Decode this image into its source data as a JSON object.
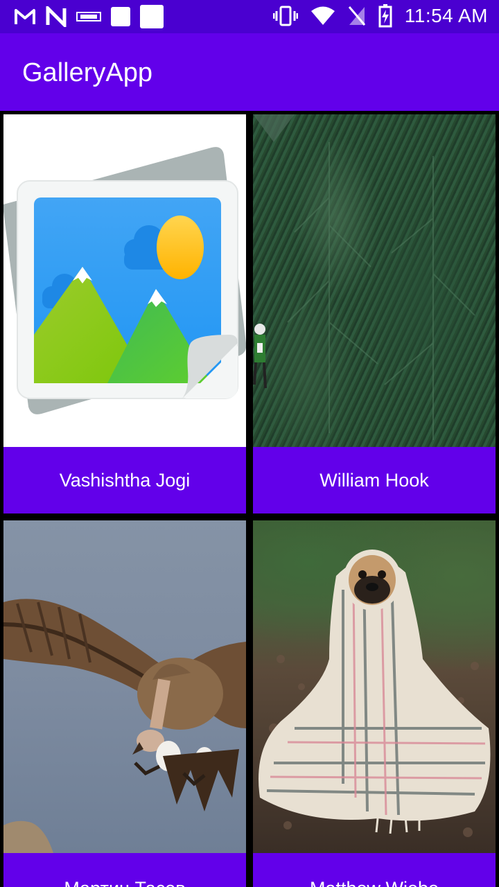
{
  "status_bar": {
    "time": "11:54 AM",
    "left_icons": [
      "gmail-icon",
      "n-app-icon",
      "notification-icon",
      "square-notification-icon",
      "square-notification-icon"
    ],
    "right_icons": [
      "vibrate-icon",
      "wifi-icon",
      "no-sim-icon",
      "battery-charging-icon"
    ]
  },
  "app_bar": {
    "title": "GalleryApp"
  },
  "gallery": {
    "items": [
      {
        "author": "Vashishtha Jogi",
        "image": "placeholder-gallery-icon"
      },
      {
        "author": "William Hook",
        "image": "pine-forest-photo"
      },
      {
        "author": "Мартин Тасев",
        "image": "vulture-photo"
      },
      {
        "author": "Matthew Wiebe",
        "image": "pug-in-blanket-photo"
      }
    ]
  },
  "colors": {
    "status_bar": "#4a00d0",
    "primary": "#6200ea",
    "background": "#000000"
  }
}
